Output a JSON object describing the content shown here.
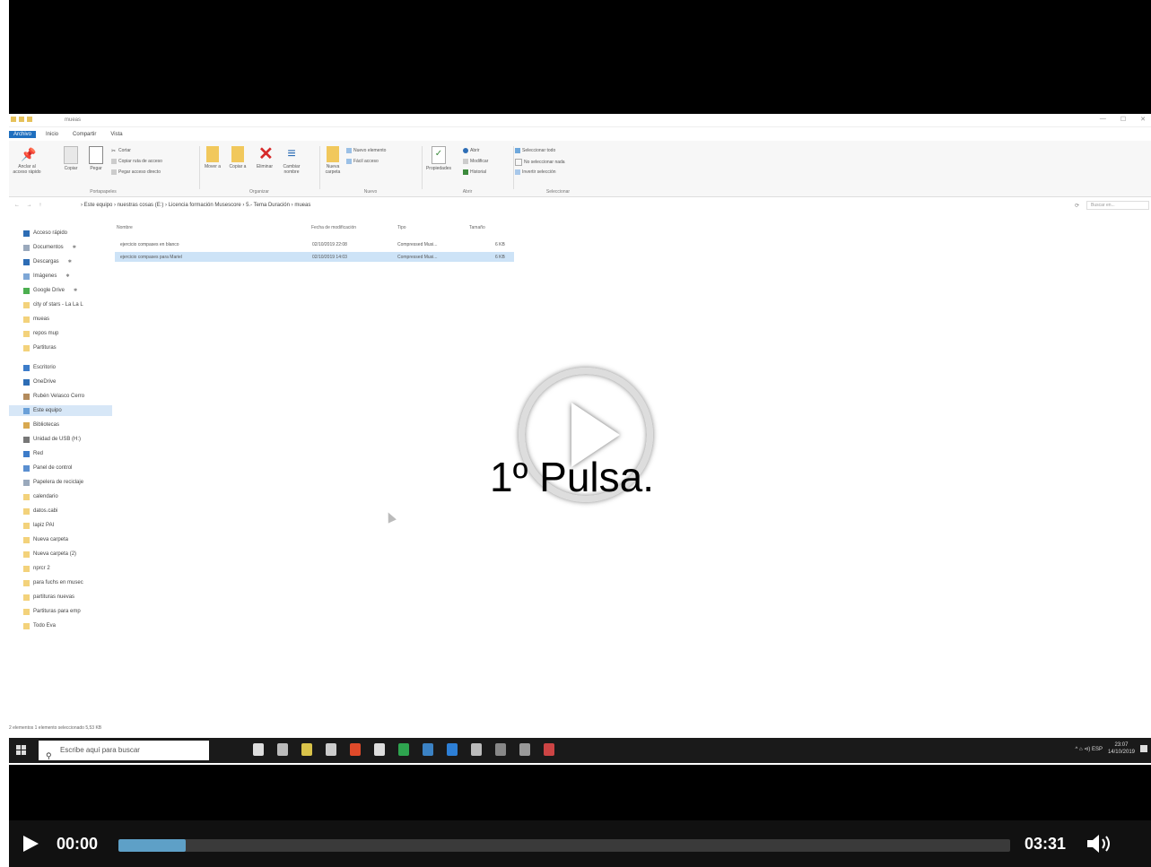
{
  "explorer": {
    "title": "mueas",
    "window_controls": [
      "—",
      "☐",
      "✕"
    ],
    "tabs": [
      "Archivo",
      "Inicio",
      "Compartir",
      "Vista"
    ],
    "ribbon": {
      "portapapeles": {
        "label": "Portapapeles",
        "anclar": "Anclar al acceso rápido",
        "copiar": "Copiar",
        "pegar": "Pegar",
        "cortar": "Cortar",
        "copiar_ruta": "Copiar ruta de acceso",
        "pegar_acceso": "Pegar acceso directo"
      },
      "organizar": {
        "label": "Organizar",
        "mover": "Mover a",
        "copiar_a": "Copiar a",
        "eliminar": "Eliminar",
        "cambiar_nombre": "Cambiar nombre"
      },
      "nuevo": {
        "label": "Nuevo",
        "nueva_carpeta": "Nueva carpeta",
        "nuevo_elemento": "Nuevo elemento",
        "facil_acceso": "Fácil acceso"
      },
      "abrir": {
        "label": "Abrir",
        "propiedades": "Propiedades",
        "abrir": "Abrir",
        "modificar": "Modificar",
        "historial": "Historial"
      },
      "seleccionar": {
        "label": "Seleccionar",
        "todo": "Seleccionar todo",
        "nada": "No seleccionar nada",
        "invertir": "Invertir selección"
      }
    },
    "breadcrumb": "› Este equipo › nuestras cosas (E:) › Licencia formación Musescore › 5.- Tema Duración › mueas",
    "search_placeholder": "Buscar en...",
    "nav_nav_arrows": "← → ↑",
    "nav": [
      {
        "label": "Acceso rápido",
        "icon": "star-icon",
        "pinned": false
      },
      {
        "label": "Documentos",
        "icon": "documents-icon",
        "pinned": true
      },
      {
        "label": "Descargas",
        "icon": "download-icon",
        "pinned": true
      },
      {
        "label": "Imágenes",
        "icon": "images-icon",
        "pinned": true
      },
      {
        "label": "Google Drive",
        "icon": "drive-icon",
        "pinned": true
      },
      {
        "label": "city of stars - La La L",
        "icon": "folder-icon",
        "pinned": false
      },
      {
        "label": "mueas",
        "icon": "folder-icon",
        "pinned": false
      },
      {
        "label": "repos mup",
        "icon": "folder-icon",
        "pinned": false
      },
      {
        "label": "Partituras",
        "icon": "folder-icon",
        "pinned": false
      },
      {
        "label": "Escritorio",
        "icon": "desktop-icon",
        "pinned": false
      },
      {
        "label": "OneDrive",
        "icon": "cloud-icon",
        "pinned": false
      },
      {
        "label": "Rubén Velasco Cerro",
        "icon": "user-icon",
        "pinned": false
      },
      {
        "label": "Este equipo",
        "icon": "computer-icon",
        "pinned": false,
        "selected": true
      },
      {
        "label": "Bibliotecas",
        "icon": "library-icon",
        "pinned": false
      },
      {
        "label": "Unidad de USB (H:)",
        "icon": "usb-icon",
        "pinned": false
      },
      {
        "label": "Red",
        "icon": "network-icon",
        "pinned": false
      },
      {
        "label": "Panel de control",
        "icon": "control-panel-icon",
        "pinned": false
      },
      {
        "label": "Papelera de reciclaje",
        "icon": "recycle-bin-icon",
        "pinned": false
      },
      {
        "label": "calendario",
        "icon": "folder-icon",
        "pinned": false
      },
      {
        "label": "datos.cabi",
        "icon": "folder-icon",
        "pinned": false
      },
      {
        "label": "lapiz PAI",
        "icon": "folder-icon",
        "pinned": false
      },
      {
        "label": "Nueva carpeta",
        "icon": "folder-icon",
        "pinned": false
      },
      {
        "label": "Nueva carpeta (2)",
        "icon": "folder-icon",
        "pinned": false
      },
      {
        "label": "nprcr 2",
        "icon": "folder-icon",
        "pinned": false
      },
      {
        "label": "para fuchs en musec",
        "icon": "folder-icon",
        "pinned": false
      },
      {
        "label": "partituras nuevas",
        "icon": "folder-icon",
        "pinned": false
      },
      {
        "label": "Partituras para emp",
        "icon": "folder-icon",
        "pinned": false
      },
      {
        "label": "Todo Eva",
        "icon": "folder-icon",
        "pinned": false
      }
    ],
    "columns": [
      "Nombre",
      "Fecha de modificación",
      "Tipo",
      "Tamaño"
    ],
    "files": [
      {
        "name": "ejercicio compases en blanco",
        "date": "02/10/2019 22:08",
        "type": "Compressed Musi...",
        "size": "6 KB",
        "selected": false
      },
      {
        "name": "ejercicio compases para Mariel",
        "date": "02/10/2019 14:03",
        "type": "Compressed Musi...",
        "size": "6 KB",
        "selected": true
      }
    ],
    "status": "2 elementos    1 elemento seleccionado  5,53 KB"
  },
  "taskbar": {
    "search_placeholder": "Escribe aquí para buscar",
    "tray_text": "^  ⌂  ⊲)  ESP",
    "time": "23:07",
    "date": "14/10/2019",
    "app_colors": [
      "#dddddd",
      "#bbbbbb",
      "#d9c34a",
      "#cccccc",
      "#e04a2a",
      "#dddddd",
      "#2ea44f",
      "#3b82c4",
      "#2d7fd6",
      "#bbbbbb",
      "#888888",
      "#999999",
      "#cc4444"
    ]
  },
  "overlay": {
    "text": "1º Pulsa."
  },
  "player": {
    "current_time": "00:00",
    "duration": "03:31",
    "buffered_fraction": 0.075
  }
}
